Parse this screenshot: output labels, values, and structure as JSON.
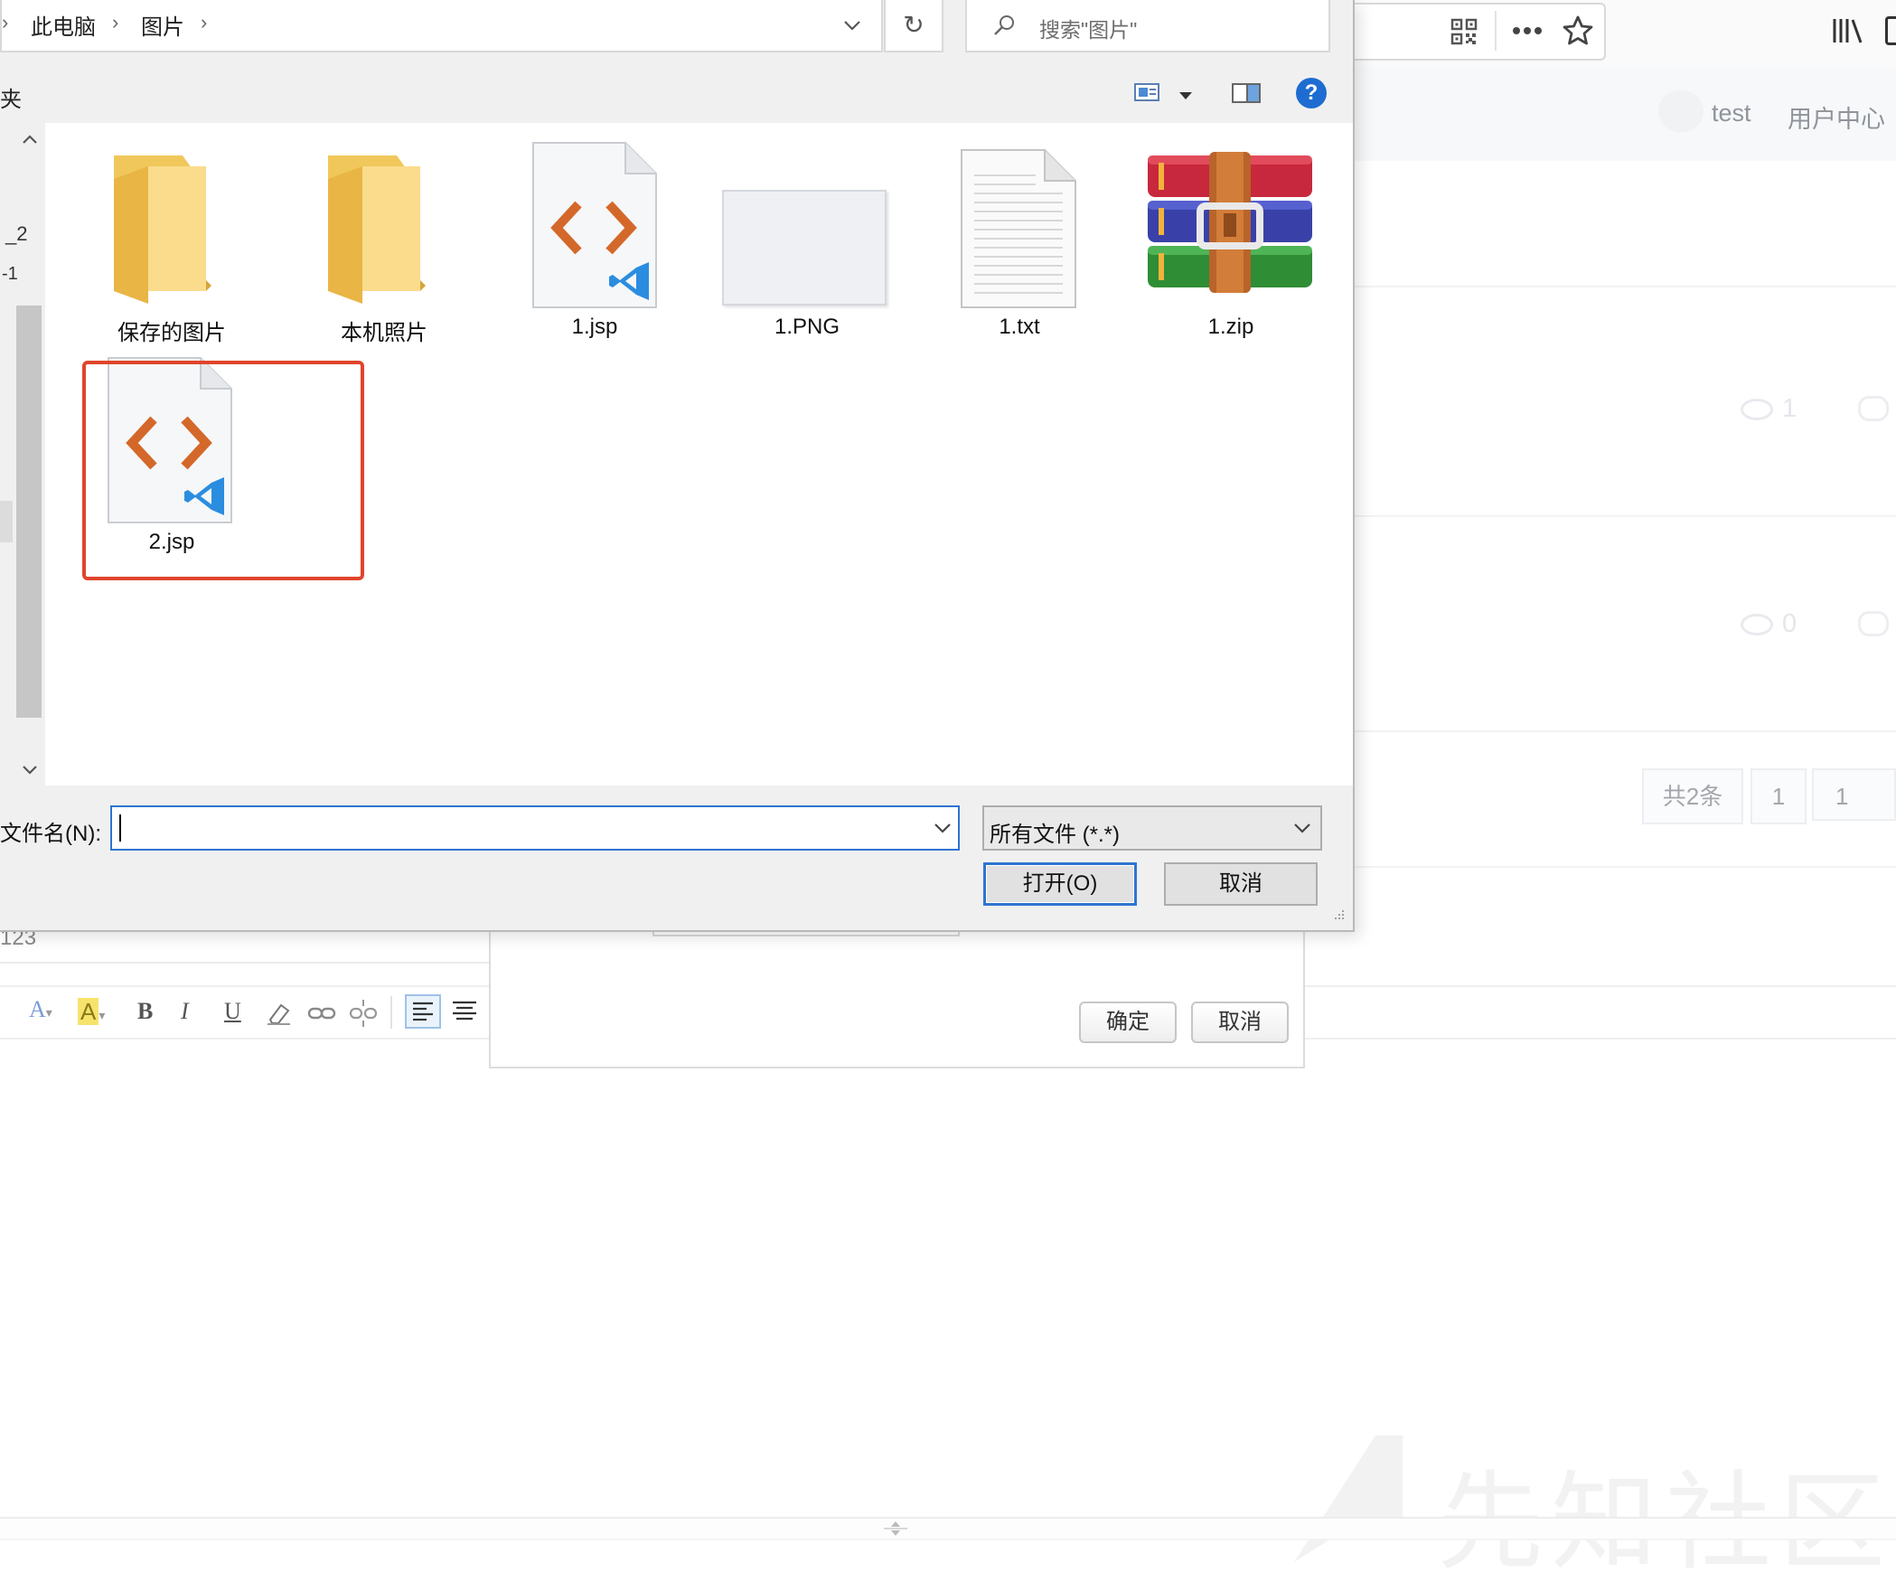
{
  "browser": {
    "icons": [
      "qr-code-icon",
      "more-icon",
      "star-icon",
      "library-icon"
    ]
  },
  "site": {
    "nav": [
      "test",
      "用户中心"
    ],
    "rows": [
      {
        "views": "1"
      },
      {
        "views": "0"
      }
    ],
    "pagination": {
      "total": "共2条",
      "page": "1",
      "jump_value": "1"
    },
    "editor_value": "123",
    "inner_dialog": {
      "confirm": "确定",
      "cancel": "取消"
    },
    "watermark": "先知社区"
  },
  "dialog": {
    "breadcrumb": [
      "此电脑",
      "图片"
    ],
    "search_placeholder": "搜索\"图片\"",
    "left_pane_label": "夹",
    "files": [
      {
        "name": "保存的图片",
        "type": "folder"
      },
      {
        "name": "本机照片",
        "type": "folder"
      },
      {
        "name": "1.jsp",
        "type": "jsp"
      },
      {
        "name": "1.PNG",
        "type": "image"
      },
      {
        "name": "1.txt",
        "type": "txt"
      },
      {
        "name": "1.zip",
        "type": "zip"
      },
      {
        "name": "2.jsp",
        "type": "jsp",
        "highlighted": true
      }
    ],
    "filename_label": "文件名(N):",
    "filename_value": "",
    "filetype_value": "所有文件 (*.*)",
    "open_button": "打开(O)",
    "cancel_button": "取消",
    "highlight_color": "#e0442b",
    "accent_color": "#2f74d0"
  }
}
